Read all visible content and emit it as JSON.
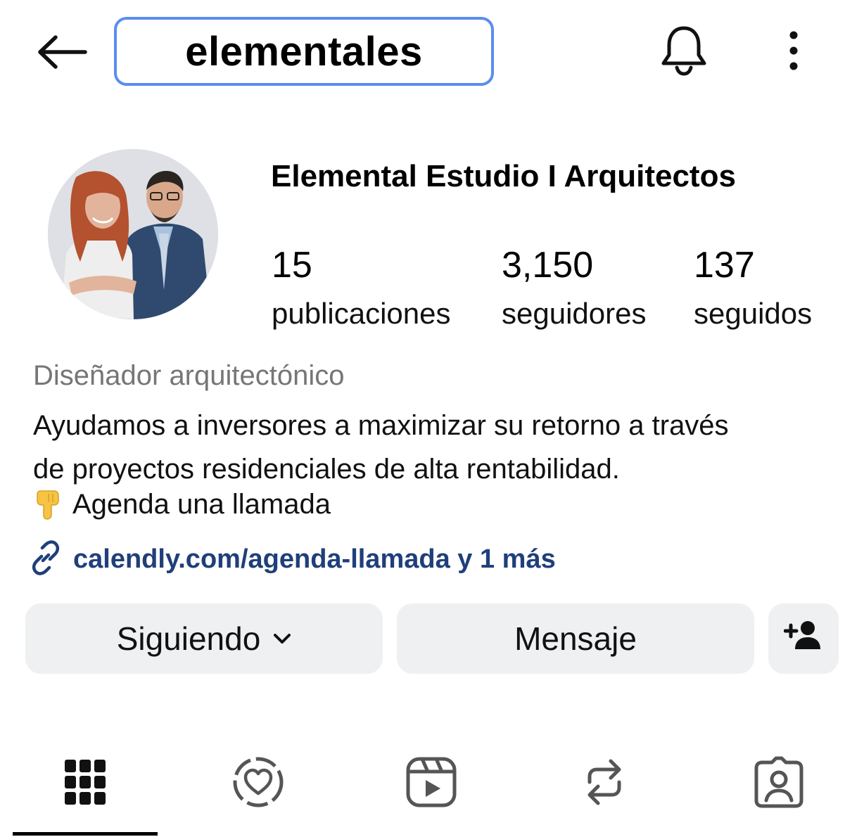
{
  "header": {
    "back_icon": "arrow-left-icon",
    "username": "elementales",
    "highlight_color": "#5b8def",
    "bell_icon": "bell-icon",
    "more_icon": "more-vertical-icon"
  },
  "profile": {
    "avatar_alt": "avatar",
    "name": "Elemental Estudio I Arquitectos",
    "stats": [
      {
        "value": "15",
        "label": "publicaciones"
      },
      {
        "value": "3,150",
        "label": "seguidores"
      },
      {
        "value": "137",
        "label": "seguidos"
      }
    ],
    "category": "Diseñador arquitectónico",
    "bio_lines": [
      "Ayudamos a inversores a maximizar su retorno a través",
      "de proyectos residenciales de alta rentabilidad."
    ],
    "cta": "Agenda una llamada",
    "cta_icon": "pointing-down-hand-icon",
    "link_icon": "link-icon",
    "link": "calendly.com/agenda-llamada y 1 más",
    "link_color": "#1f3f7a"
  },
  "actions": {
    "following_label": "Siguiendo",
    "following_icon": "chevron-down-icon",
    "message_label": "Mensaje",
    "add_user_icon": "add-user-icon",
    "button_bg": "#eff0f2"
  },
  "tabs": [
    {
      "name": "grid",
      "icon": "grid-icon",
      "active": true
    },
    {
      "name": "highlights",
      "icon": "heart-circle-icon",
      "active": false
    },
    {
      "name": "reels",
      "icon": "reels-icon",
      "active": false
    },
    {
      "name": "reposts",
      "icon": "repost-icon",
      "active": false
    },
    {
      "name": "tagged",
      "icon": "tagged-person-icon",
      "active": false
    }
  ]
}
